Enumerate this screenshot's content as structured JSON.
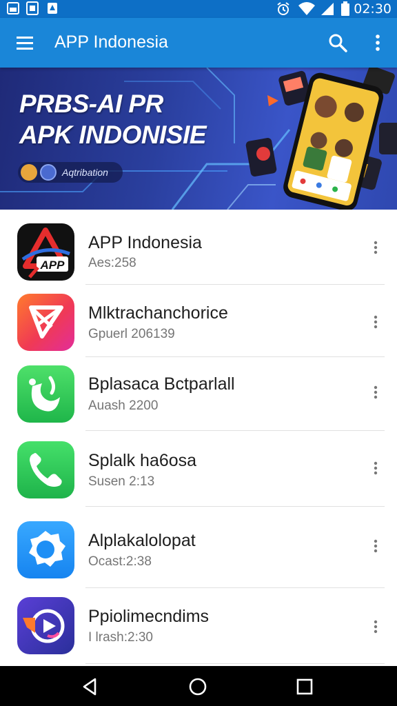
{
  "status_bar": {
    "time": "02:30",
    "left_icons": [
      "gallery-icon",
      "screenshot-icon",
      "notification-icon"
    ],
    "right_icons": [
      "alarm-icon",
      "wifi-icon",
      "signal-icon",
      "battery-icon"
    ]
  },
  "app_bar": {
    "title": "APP Indonesia",
    "menu_icon": "menu-icon",
    "search_icon": "search-icon",
    "more_icon": "more-vert-icon",
    "color": "#1a86d8"
  },
  "banner": {
    "line1": "PRBS-AI PR",
    "line2": "APK INDONISIE",
    "badge_text": "Aqtribation"
  },
  "apps": [
    {
      "name": "APP Indonesia",
      "subtitle": "Aes:258",
      "icon": "app-indonesia-logo-icon"
    },
    {
      "name": "Mlktrachanchorice",
      "subtitle": "Gpuerl 206139",
      "icon": "red-pink-logo-icon"
    },
    {
      "name": "Bplasaca Bctparlall",
      "subtitle": "Auash 2200",
      "icon": "green-leaf-icon"
    },
    {
      "name": "Splalk ha6osa",
      "subtitle": "Susen 2:13",
      "icon": "phone-icon"
    },
    {
      "name": "Alplakalolopat",
      "subtitle": "Ocast:2:38",
      "icon": "blue-gear-icon"
    },
    {
      "name": "Ppiolimecndims",
      "subtitle": "I lrash:2:30",
      "icon": "play-logo-icon"
    }
  ],
  "nav_bar": {
    "icons": [
      "back-icon",
      "home-icon",
      "recents-icon"
    ]
  }
}
